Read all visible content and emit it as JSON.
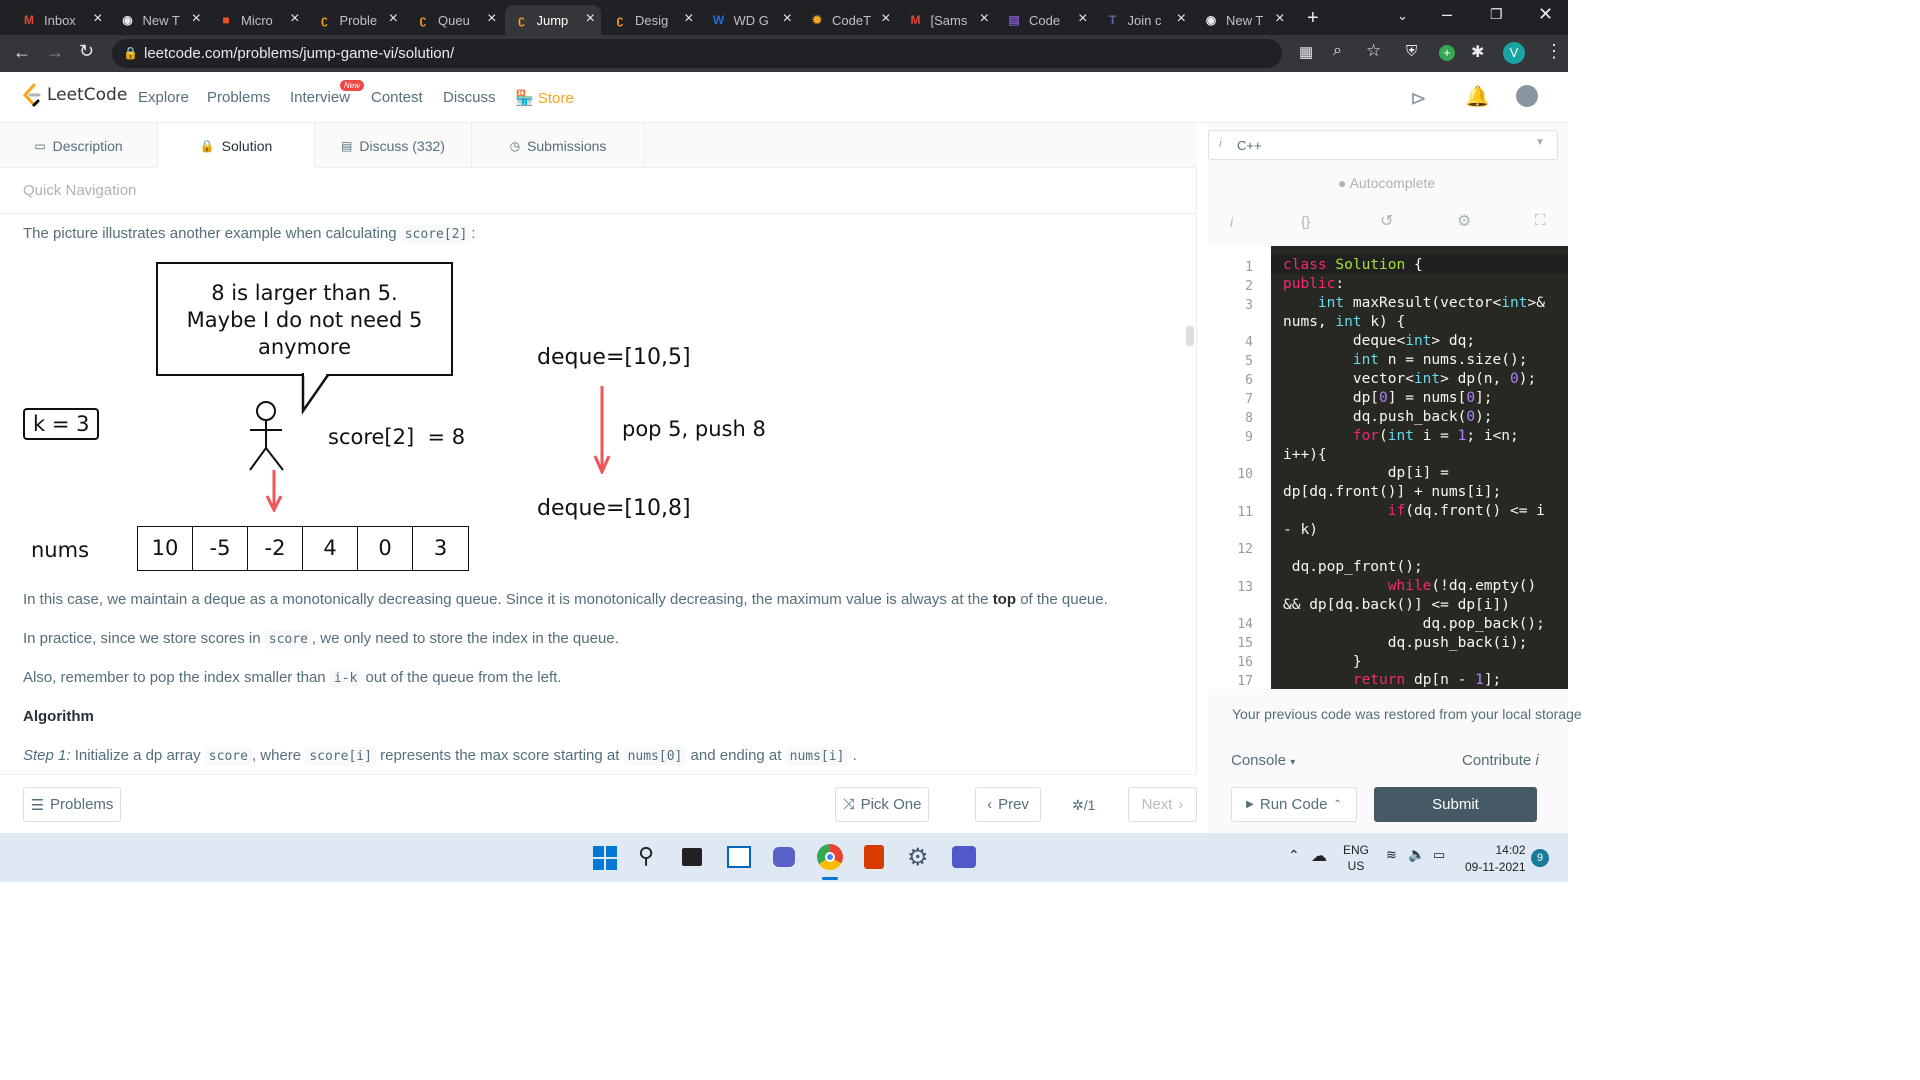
{
  "browser": {
    "tabs": [
      {
        "label": "Inbox",
        "icon": "gmail-icon",
        "color": "#ea4335"
      },
      {
        "label": "New T",
        "icon": "chrome-icon",
        "color": "#e8eaed"
      },
      {
        "label": "Micro",
        "icon": "microsoft-icon",
        "color": "#f25022"
      },
      {
        "label": "Proble",
        "icon": "leetcode-icon",
        "color": "#ffa116"
      },
      {
        "label": "Queu",
        "icon": "leetcode-icon",
        "color": "#ffa116"
      },
      {
        "label": "Jump",
        "icon": "leetcode-icon",
        "color": "#ffa116"
      },
      {
        "label": "Desig",
        "icon": "leetcode-icon",
        "color": "#ffa116"
      },
      {
        "label": "WD G",
        "icon": "wd-icon",
        "color": "#1f6fe0"
      },
      {
        "label": "CodeT",
        "icon": "codechef-icon",
        "color": "#f5a623"
      },
      {
        "label": "[Sams",
        "icon": "gmail-icon",
        "color": "#ea4335"
      },
      {
        "label": "Code",
        "icon": "form-icon",
        "color": "#7e57c2"
      },
      {
        "label": "Join c",
        "icon": "teams-icon",
        "color": "#6264a7"
      },
      {
        "label": "New T",
        "icon": "chrome-icon",
        "color": "#e8eaed"
      }
    ],
    "active_tab_index": 5,
    "url": "leetcode.com/problems/jump-game-vi/solution/",
    "profile_initial": "V"
  },
  "lc_nav": {
    "logo_text": "LeetCode",
    "items": [
      "Explore",
      "Problems",
      "Interview",
      "Contest",
      "Discuss"
    ],
    "new_badge": "New",
    "store": "Store"
  },
  "tabs": {
    "description": "Description",
    "solution": "Solution",
    "discuss": "Discuss (332)",
    "submissions": "Submissions"
  },
  "quick_nav": "Quick Navigation",
  "article": {
    "intro_pre": "The picture illustrates another example when calculating",
    "intro_code": "score[2]",
    "intro_post": ":",
    "p1_pre": "In this case, we maintain a deque as a monotonically decreasing queue. Since it is monotonically decreasing, the maximum value is always at the",
    "p1_bold": "top",
    "p1_post": "of the queue.",
    "p2_pre": "In practice, since we store scores in",
    "p2_code": "score",
    "p2_post": ", we only need to store the index in the queue.",
    "p3_pre": "Also, remember to pop the index smaller than",
    "p3_code": "i-k",
    "p3_post": "out of the queue from the left.",
    "heading": "Algorithm",
    "step_em": "Step 1:",
    "step_a": "Initialize a dp array",
    "step_c1": "score",
    "step_b": ", where",
    "step_c2": "score[i]",
    "step_c": "represents the max score starting at",
    "step_c3": "nums[0]",
    "step_d": "and ending at",
    "step_c4": "nums[i]",
    "step_e": "."
  },
  "figure": {
    "bubble_l1": "8 is larger than 5.",
    "bubble_l2": "Maybe I do not need 5",
    "bubble_l3": "anymore",
    "k_label": "k = 3",
    "score_label": "score[2]  = 8",
    "deque_before": "deque=[10,5]",
    "op": "pop 5, push 8",
    "deque_after": "deque=[10,8]",
    "nums_label": "nums",
    "nums": [
      "10",
      "-5",
      "-2",
      "4",
      "0",
      "3"
    ]
  },
  "editor": {
    "language": "C++",
    "autocomplete": "Autocomplete",
    "line_numbers": [
      "1",
      "2",
      "3",
      "4",
      "5",
      "6",
      "7",
      "8",
      "9",
      "10",
      "11",
      "12",
      "13",
      "14",
      "15",
      "16",
      "17"
    ],
    "restore_msg": "Your previous code was restored from your local storage",
    "console": "Console",
    "contribute": "Contribute"
  },
  "bottom": {
    "problems": "Problems",
    "pick_one": "Pick One",
    "prev": "Prev",
    "page": "/1",
    "next": "Next",
    "run_code": "Run Code",
    "submit": "Submit"
  },
  "taskbar": {
    "lang1": "ENG",
    "lang2": "US",
    "time": "14:02",
    "date": "09-11-2021",
    "notif_count": "9"
  }
}
